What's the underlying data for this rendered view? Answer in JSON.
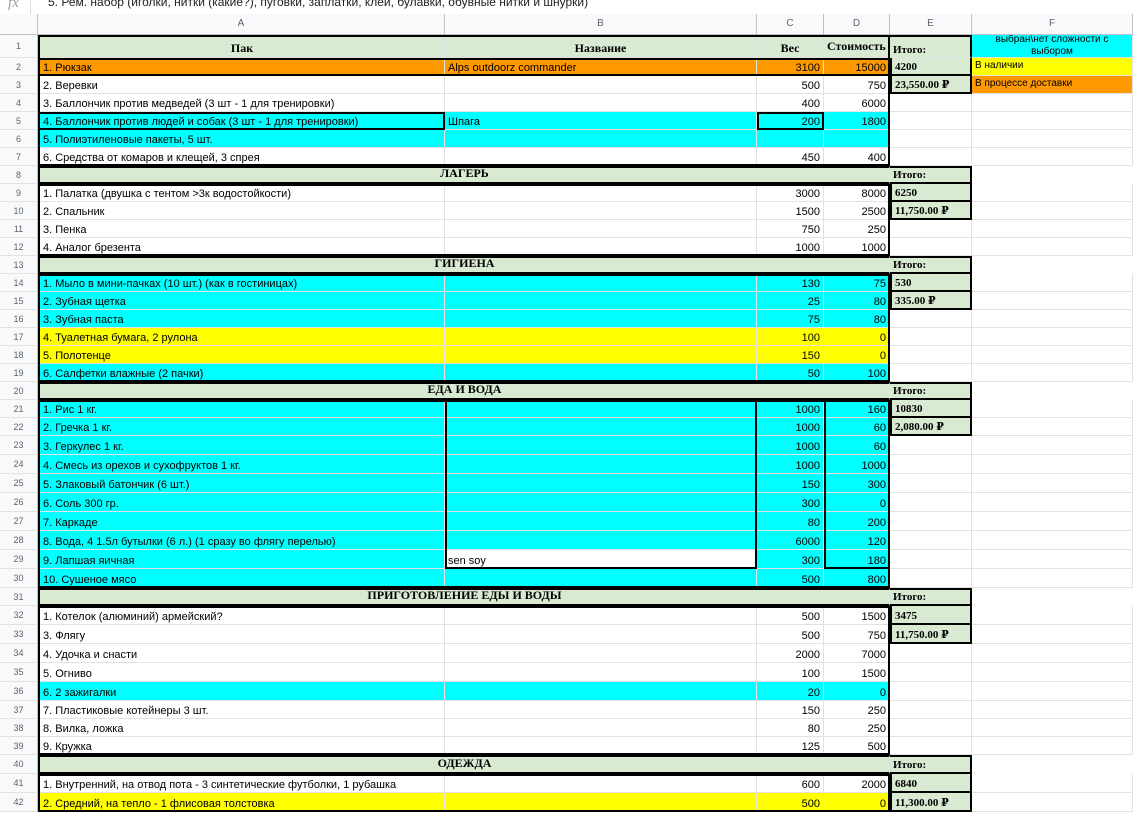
{
  "formula_bar": {
    "fx_icon": "fx",
    "content": "5. Рем. набор (иголки, нитки (какие?), пуговки, заплатки, клей, булавки, обувные нитки и шнурки)"
  },
  "columns": [
    "A",
    "B",
    "C",
    "D",
    "E",
    "F"
  ],
  "legend": {
    "selected_label": "выбран\\нет сложности с выбором",
    "in_stock_label": "В наличии",
    "in_delivery_label": "В процессе доставки",
    "colors": {
      "selected": "#00ffff",
      "in_stock": "#ffff00",
      "in_delivery": "#ff9900"
    }
  },
  "header_row": {
    "pack": "Пак",
    "name": "Название",
    "weight": "Вес",
    "cost": "Стоимость",
    "total": "Итого:"
  },
  "rows": [
    {
      "num": "1"
    },
    {
      "num": "2",
      "a": "1. Рюкзак",
      "b": "Alps outdoorz commander",
      "c": "3100",
      "d": "15000",
      "e": "4200"
    },
    {
      "num": "3",
      "a": "2. Веревки",
      "b": "",
      "c": "500",
      "d": "750",
      "e": "23,550.00 ₽"
    },
    {
      "num": "4",
      "a": "3. Баллончик против медведей (3 шт - 1 для тренировки)",
      "b": "",
      "c": "400",
      "d": "6000"
    },
    {
      "num": "5",
      "a": "4. Баллончик против людей и собак (3 шт - 1 для тренировки)",
      "b": "Шпага",
      "c": "200",
      "d": "1800"
    },
    {
      "num": "6",
      "a": "5. Полиэтиленовые пакеты, 5 шт.",
      "b": "",
      "c": "",
      "d": ""
    },
    {
      "num": "7",
      "a": "6. Средства от комаров и клещей, 3 спрея",
      "b": "",
      "c": "450",
      "d": "400"
    },
    {
      "num": "8",
      "section": "ЛАГЕРЬ",
      "e": "Итого:"
    },
    {
      "num": "9",
      "a": "1. Палатка (двушка с тентом >3к водостойкости)",
      "b": "",
      "c": "3000",
      "d": "8000",
      "e": "6250"
    },
    {
      "num": "10",
      "a": "2. Спальник",
      "b": "",
      "c": "1500",
      "d": "2500",
      "e": "11,750.00 ₽"
    },
    {
      "num": "11",
      "a": "3. Пенка",
      "b": "",
      "c": "750",
      "d": "250"
    },
    {
      "num": "12",
      "a": "4. Аналог брезента",
      "b": "",
      "c": "1000",
      "d": "1000"
    },
    {
      "num": "13",
      "section": "ГИГИЕНА",
      "e": "Итого:"
    },
    {
      "num": "14",
      "a": "1. Мыло в мини-пачках (10 шт.) (как в гостиницах)",
      "b": "",
      "c": "130",
      "d": "75",
      "e": "530"
    },
    {
      "num": "15",
      "a": "2. Зубная щетка",
      "b": "",
      "c": "25",
      "d": "80",
      "e": "335.00 ₽"
    },
    {
      "num": "16",
      "a": "3. Зубная паста",
      "b": "",
      "c": "75",
      "d": "80"
    },
    {
      "num": "17",
      "a": "4. Туалетная бумага, 2 рулона",
      "b": "",
      "c": "100",
      "d": "0"
    },
    {
      "num": "18",
      "a": "5. Полотенце",
      "b": "",
      "c": "150",
      "d": "0"
    },
    {
      "num": "19",
      "a": "6. Салфетки влажные (2 пачки)",
      "b": "",
      "c": "50",
      "d": "100"
    },
    {
      "num": "20",
      "section": "ЕДА И ВОДА",
      "e": "Итого:"
    },
    {
      "num": "21",
      "a": "1. Рис 1 кг.",
      "b": "",
      "c": "1000",
      "d": "160",
      "e": "10830"
    },
    {
      "num": "22",
      "a": "2. Гречка 1 кг.",
      "b": "",
      "c": "1000",
      "d": "60",
      "e": "2,080.00 ₽"
    },
    {
      "num": "23",
      "a": "3. Геркулес 1 кг.",
      "b": "",
      "c": "1000",
      "d": "60"
    },
    {
      "num": "24",
      "a": "4. Смесь из орехов и сухофруктов 1 кг.",
      "b": "",
      "c": "1000",
      "d": "1000"
    },
    {
      "num": "25",
      "a": "5. Злаковый батончик (6 шт.)",
      "b": "",
      "c": "150",
      "d": "300"
    },
    {
      "num": "26",
      "a": "6. Соль 300 гр.",
      "b": "",
      "c": "300",
      "d": "0"
    },
    {
      "num": "27",
      "a": "7. Каркаде",
      "b": "",
      "c": "80",
      "d": "200"
    },
    {
      "num": "28",
      "a": "8. Вода, 4 1.5л бутылки (6 л.) (1 сразу во флягу перелью)",
      "b": "",
      "c": "6000",
      "d": "120"
    },
    {
      "num": "29",
      "a": "9. Лапшая яичная",
      "b": "sen soy",
      "c": "300",
      "d": "180"
    },
    {
      "num": "30",
      "a": "10. Сушеное мясо",
      "b": "",
      "c": "500",
      "d": "800"
    },
    {
      "num": "31",
      "section": "ПРИГОТОВЛЕНИЕ ЕДЫ И ВОДЫ",
      "e": "Итого:"
    },
    {
      "num": "32",
      "a": "1. Котелок (алюминий) армейский?",
      "b": "",
      "c": "500",
      "d": "1500",
      "e": "3475"
    },
    {
      "num": "33",
      "a": "3. Флягу",
      "b": "",
      "c": "500",
      "d": "750",
      "e": "11,750.00 ₽"
    },
    {
      "num": "34",
      "a": "4. Удочка и снасти",
      "b": "",
      "c": "2000",
      "d": "7000"
    },
    {
      "num": "35",
      "a": "5. Огниво",
      "b": "",
      "c": "100",
      "d": "1500"
    },
    {
      "num": "36",
      "a": "6. 2 зажигалки",
      "b": "",
      "c": "20",
      "d": "0"
    },
    {
      "num": "37",
      "a": "7. Пластиковые котейнеры 3 шт.",
      "b": "",
      "c": "150",
      "d": "250"
    },
    {
      "num": "38",
      "a": "8. Вилка, ложка",
      "b": "",
      "c": "80",
      "d": "250"
    },
    {
      "num": "39",
      "a": "9. Кружка",
      "b": "",
      "c": "125",
      "d": "500"
    },
    {
      "num": "40",
      "section": "ОДЕЖДА",
      "e": "Итого:"
    },
    {
      "num": "41",
      "a": "1. Внутренний, на отвод пота - 3 синтетические футболки, 1 рубашка",
      "b": "",
      "c": "600",
      "d": "2000",
      "e": "6840"
    },
    {
      "num": "42",
      "a": "2. Средний, на тепло - 1 флисовая толстовка",
      "b": "",
      "c": "500",
      "d": "0",
      "e": "11,300.00 ₽"
    }
  ]
}
